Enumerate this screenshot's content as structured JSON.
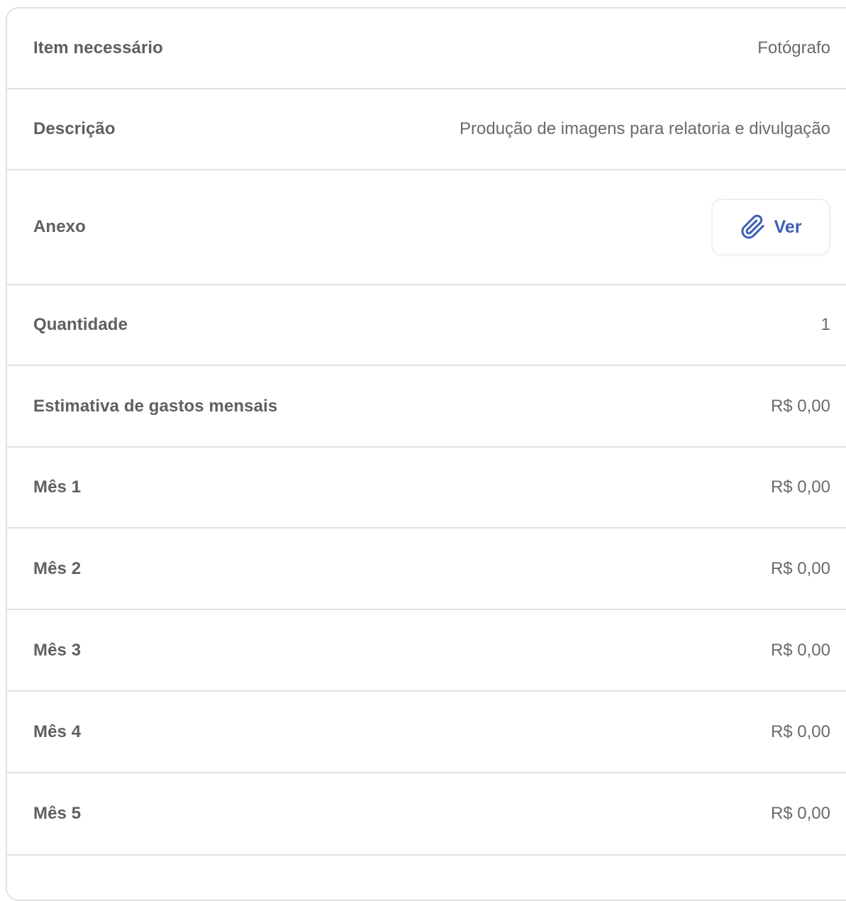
{
  "colors": {
    "label": "#5f5f5f",
    "value": "#6a6a6a",
    "accent": "#3f5fb5",
    "divider": "#e3e3e3"
  },
  "rows": [
    {
      "label": "Item necessário",
      "value": "Fotógrafo"
    },
    {
      "label": "Descrição",
      "value": "Produção de imagens para relatoria e divulgação"
    },
    {
      "label": "Anexo",
      "button": {
        "label": "Ver",
        "icon": "paperclip-icon"
      }
    },
    {
      "label": "Quantidade",
      "value": "1"
    },
    {
      "label": "Estimativa de gastos mensais",
      "value": "R$ 0,00"
    },
    {
      "label": "Mês 1",
      "value": "R$ 0,00"
    },
    {
      "label": "Mês 2",
      "value": "R$ 0,00"
    },
    {
      "label": "Mês 3",
      "value": "R$ 0,00"
    },
    {
      "label": "Mês 4",
      "value": "R$ 0,00"
    },
    {
      "label": "Mês 5",
      "value": "R$ 0,00"
    }
  ]
}
